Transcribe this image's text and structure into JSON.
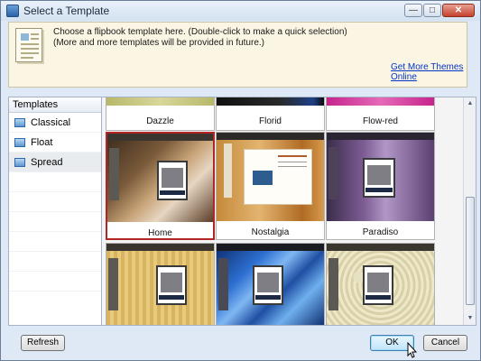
{
  "window": {
    "title": "Select a Template"
  },
  "header": {
    "line1": "Choose a flipbook template here. (Double-click to make a quick selection)",
    "line2": "(More and more templates will be provided in future.)",
    "link": "Get More Themes Online"
  },
  "left_panel": {
    "header": "Templates",
    "items": [
      {
        "label": "Classical",
        "selected": false
      },
      {
        "label": "Float",
        "selected": false
      },
      {
        "label": "Spread",
        "selected": true
      }
    ]
  },
  "templates": [
    {
      "name": "Dazzle"
    },
    {
      "name": "Florid"
    },
    {
      "name": "Flow-red"
    },
    {
      "name": "Home",
      "selected": true
    },
    {
      "name": "Nostalgia"
    },
    {
      "name": "Paradiso"
    },
    {
      "name": ""
    },
    {
      "name": ""
    },
    {
      "name": ""
    }
  ],
  "buttons": {
    "refresh": "Refresh",
    "ok": "OK",
    "cancel": "Cancel"
  },
  "colors": {
    "selection_border": "#b32424",
    "link": "#0033cc"
  }
}
